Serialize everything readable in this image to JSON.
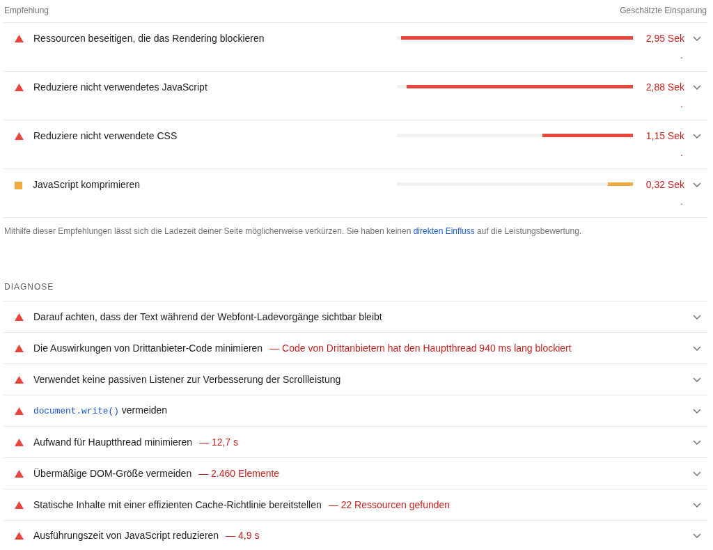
{
  "columns": [
    "Empfehlung",
    "Geschätzte Einsparung"
  ],
  "opportunities": [
    {
      "kind": "fail",
      "title": "Ressourcen beseitigen, die das Rendering blockieren",
      "level": 0.983,
      "savings": "2,95 Sek",
      "suffix": "."
    },
    {
      "kind": "fail",
      "title": "Reduziere nicht verwendetes JavaScript",
      "level": 0.96,
      "savings": "2,88 Sek",
      "suffix": "."
    },
    {
      "kind": "fail",
      "title": "Reduziere nicht verwendete CSS",
      "level": 0.383,
      "savings": "1,15 Sek",
      "suffix": "."
    },
    {
      "kind": "average",
      "title": "JavaScript komprimieren",
      "level": 0.107,
      "savings": "0,32 Sek",
      "suffix": "."
    }
  ],
  "note": {
    "text_before": "Mithilfe dieser Empfehlungen lässt sich die Ladezeit deiner Seite möglicherweise verkürzen. Sie haben keinen ",
    "link": "direkten Einfluss",
    "text_after": " auf die Leistungsbewertung."
  },
  "diagnostics": {
    "heading": "DIAGNOSE",
    "items": [
      {
        "kind": "fail",
        "title": "Darauf achten, dass der Text während der Webfont-Ladevorgänge sichtbar bleibt"
      },
      {
        "kind": "fail",
        "title": "Die Auswirkungen von Drittanbieter-Code minimieren",
        "detail": "— Code von Drittanbietern hat den Hauptthread 940 ms lang blockiert"
      },
      {
        "kind": "fail",
        "title": "Verwendet keine passiven Listener zur Verbesserung der Scrollleistung"
      },
      {
        "kind": "fail",
        "code": "document.write()",
        "title": "vermeiden"
      },
      {
        "kind": "fail",
        "title": "Aufwand für Hauptthread minimieren",
        "detail": "— 12,7 s"
      },
      {
        "kind": "fail",
        "title": "Übermäßige DOM-Größe vermeiden",
        "detail": "— 2.460 Elemente"
      },
      {
        "kind": "fail",
        "title": "Statische Inhalte mit einer effizienten Cache-Richtlinie bereitstellen",
        "detail": "— 22 Ressourcen gefunden"
      },
      {
        "kind": "fail",
        "title": "Ausführungszeit von JavaScript reduzieren",
        "detail": "— 4,9 s"
      }
    ]
  }
}
